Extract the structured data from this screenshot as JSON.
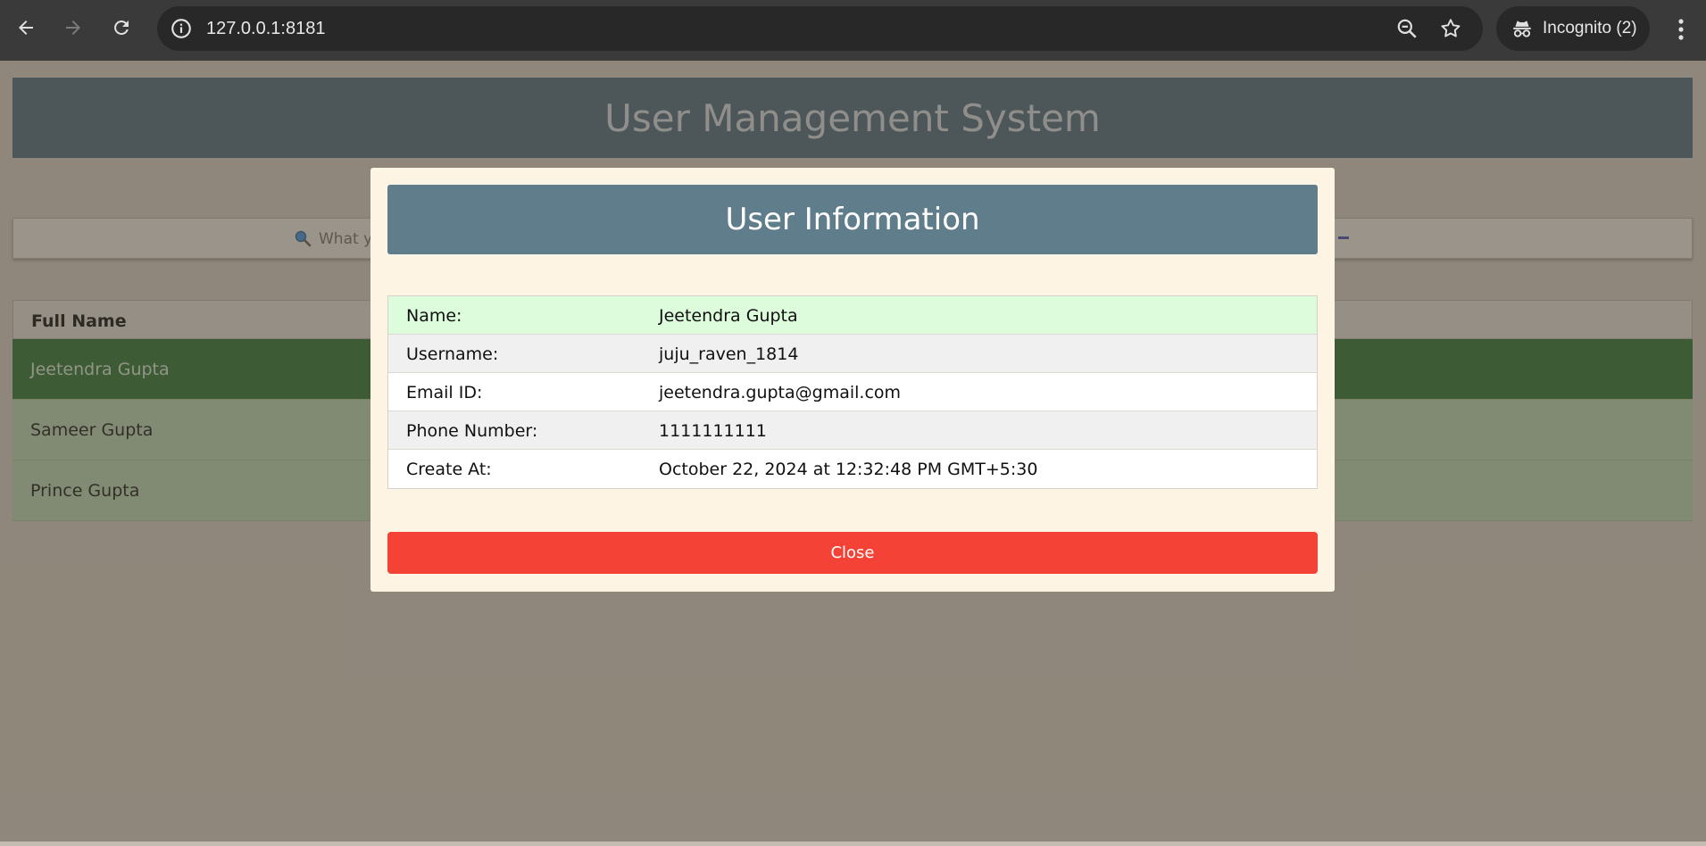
{
  "browser": {
    "url": "127.0.0.1:8181",
    "incognito_label": "Incognito (2)",
    "icons": [
      "back-icon",
      "forward-icon",
      "reload-icon",
      "info-icon",
      "zoom-icon",
      "star-icon",
      "incognito-icon",
      "menu-icon"
    ]
  },
  "app": {
    "title": "User Management System",
    "search_placeholder": "What y",
    "table": {
      "header": "Full Name",
      "rows": [
        "Jeetendra Gupta",
        "Sameer Gupta",
        "Prince Gupta"
      ]
    }
  },
  "modal": {
    "title": "User Information",
    "fields": [
      {
        "label": "Name:",
        "value": "Jeetendra Gupta"
      },
      {
        "label": "Username:",
        "value": "juju_raven_1814"
      },
      {
        "label": "Email ID:",
        "value": "jeetendra.gupta@gmail.com"
      },
      {
        "label": "Phone Number:",
        "value": "1111111111"
      },
      {
        "label": "Create At:",
        "value": "October 22, 2024 at 12:32:48 PM GMT+5:30"
      }
    ],
    "close_label": "Close"
  },
  "colors": {
    "header_bg": "#4b6473",
    "modal_header_bg": "#607d8b",
    "selected_row": "#2e6c30",
    "row_bg": "#aac3a3",
    "close_button": "#f44336",
    "modal_bg": "#fdf4e3"
  }
}
